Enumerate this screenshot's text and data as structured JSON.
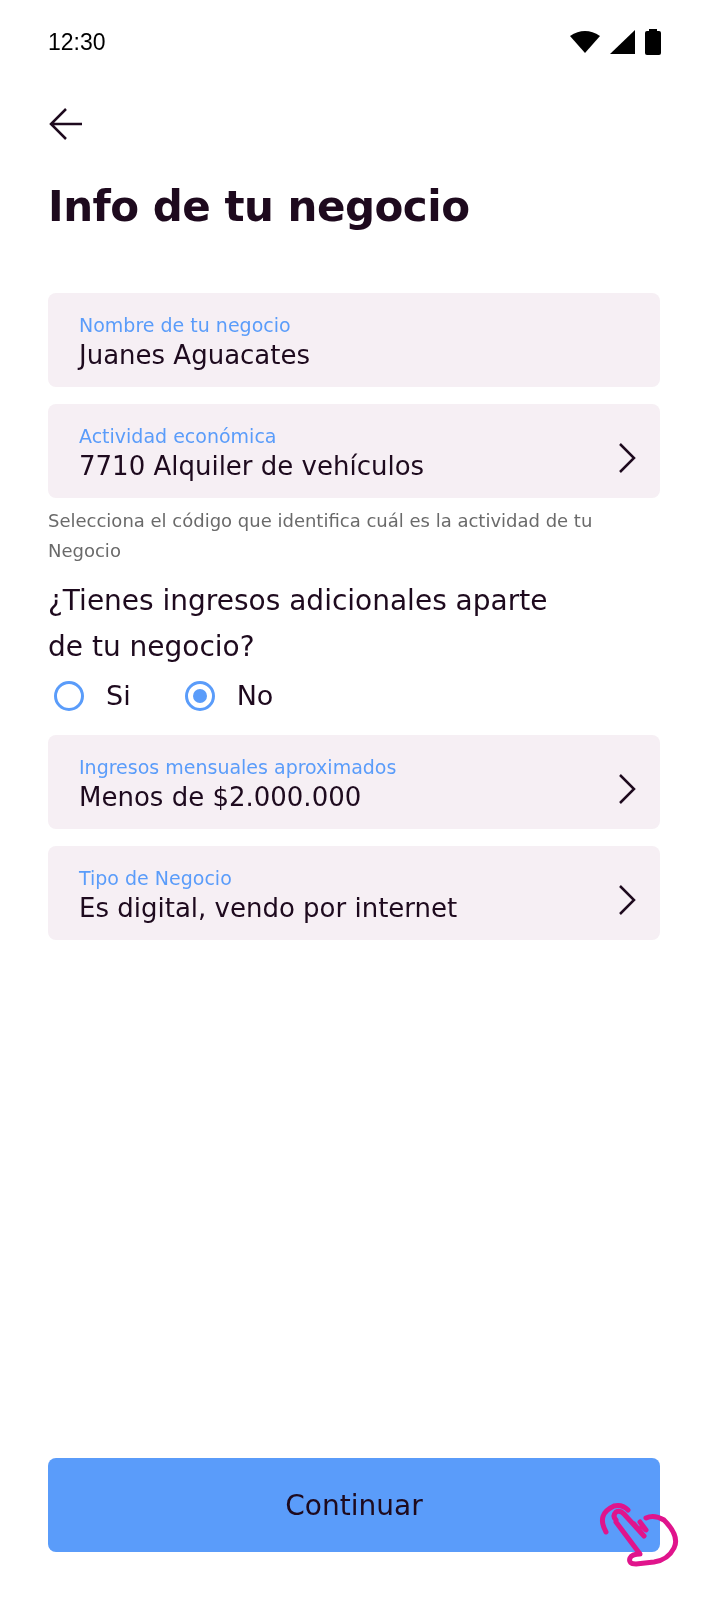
{
  "status_bar": {
    "time": "12:30"
  },
  "title": "Info de tu negocio",
  "fields": [
    {
      "kind": "text",
      "label": "Nombre de tu negocio",
      "value": "Juanes Aguacates"
    },
    {
      "kind": "select",
      "label": "Actividad económica",
      "value": "7710 Alquiler de vehículos",
      "helper": "Selecciona el código que identifica cuál es la actividad de tu Negocio"
    }
  ],
  "question": {
    "text": "¿Tienes ingresos adicionales aparte de tu negocio?",
    "options": [
      {
        "label": "Si",
        "selected": false
      },
      {
        "label": "No",
        "selected": true
      }
    ]
  },
  "more_fields": [
    {
      "kind": "select",
      "label": "Ingresos mensuales aproximados",
      "value": "Menos de $2.000.000"
    },
    {
      "kind": "select",
      "label": "Tipo de Negocio",
      "value": "Es digital, vendo por internet"
    }
  ],
  "button": {
    "label": "Continuar"
  }
}
